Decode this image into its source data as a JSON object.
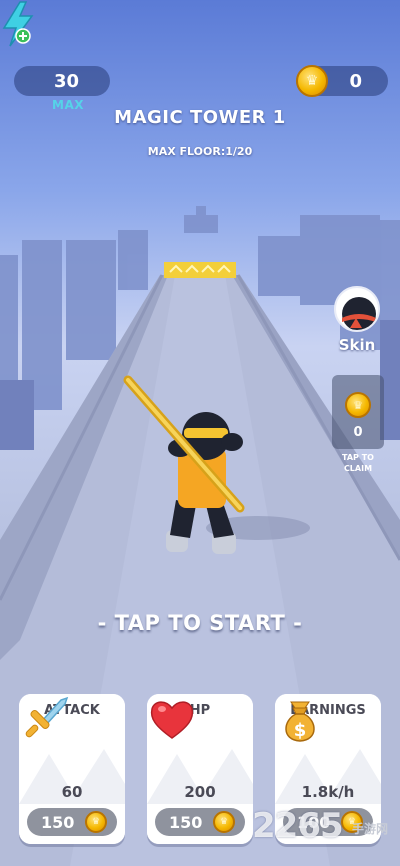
{
  "hud": {
    "energy_value": "30",
    "energy_max_label": "MAX",
    "coins_value": "0"
  },
  "level": {
    "title": "MAGIC TOWER 1",
    "subtitle": "MAX FLOOR:1/20"
  },
  "side": {
    "skin_label": "Skin",
    "claim_value": "0",
    "claim_label_line1": "TAP TO",
    "claim_label_line2": "CLAIM"
  },
  "prompt": "- TAP TO START -",
  "upgrades": [
    {
      "title": "ATTACK",
      "value": "60",
      "cost": "150",
      "icon": "sword-icon"
    },
    {
      "title": "HP",
      "value": "200",
      "cost": "150",
      "icon": "heart-icon"
    },
    {
      "title": "EARNINGS",
      "value": "1.8k/h",
      "cost": "100",
      "icon": "money-bag-icon"
    }
  ],
  "watermark": {
    "number": "2265",
    "text": "手游网"
  },
  "colors": {
    "sky_top": "#5b7bd6",
    "coin": "#f5b800",
    "accent_cyan": "#55d3e8",
    "player_shirt": "#f5a623",
    "cost_pill": "#8f939e"
  }
}
